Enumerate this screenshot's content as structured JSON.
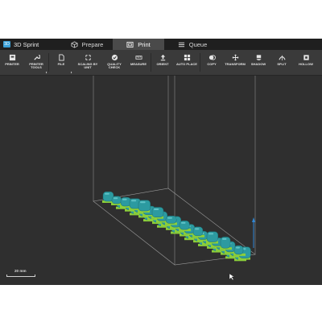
{
  "app": {
    "name": "3D Sprint"
  },
  "tabs": [
    {
      "label": "Prepare",
      "icon": "cube-icon",
      "active": false
    },
    {
      "label": "Print",
      "icon": "print-icon",
      "active": true
    },
    {
      "label": "Queue",
      "icon": "list-icon",
      "active": false
    }
  ],
  "toolbar": {
    "printer": "PRINTER",
    "printer_tools": "PRINTER\nTOOLS",
    "file": "FILE",
    "scaling": "SCALING BY\nUNIT",
    "quality": "QUALITY\nCHECK",
    "measure": "MEASURE",
    "orient": "ORIENT",
    "auto_place": "AUTO PLACE",
    "copy": "COPY",
    "transform": "TRANSFORM",
    "shadow": "SHADOW",
    "split": "SPLIT",
    "hollow": "HOLLOW"
  },
  "viewport": {
    "scale_label": "20 mm",
    "model_color": "#2c9aa0",
    "support_color": "#8ccf3a",
    "background_color": "#2f2f2f"
  }
}
